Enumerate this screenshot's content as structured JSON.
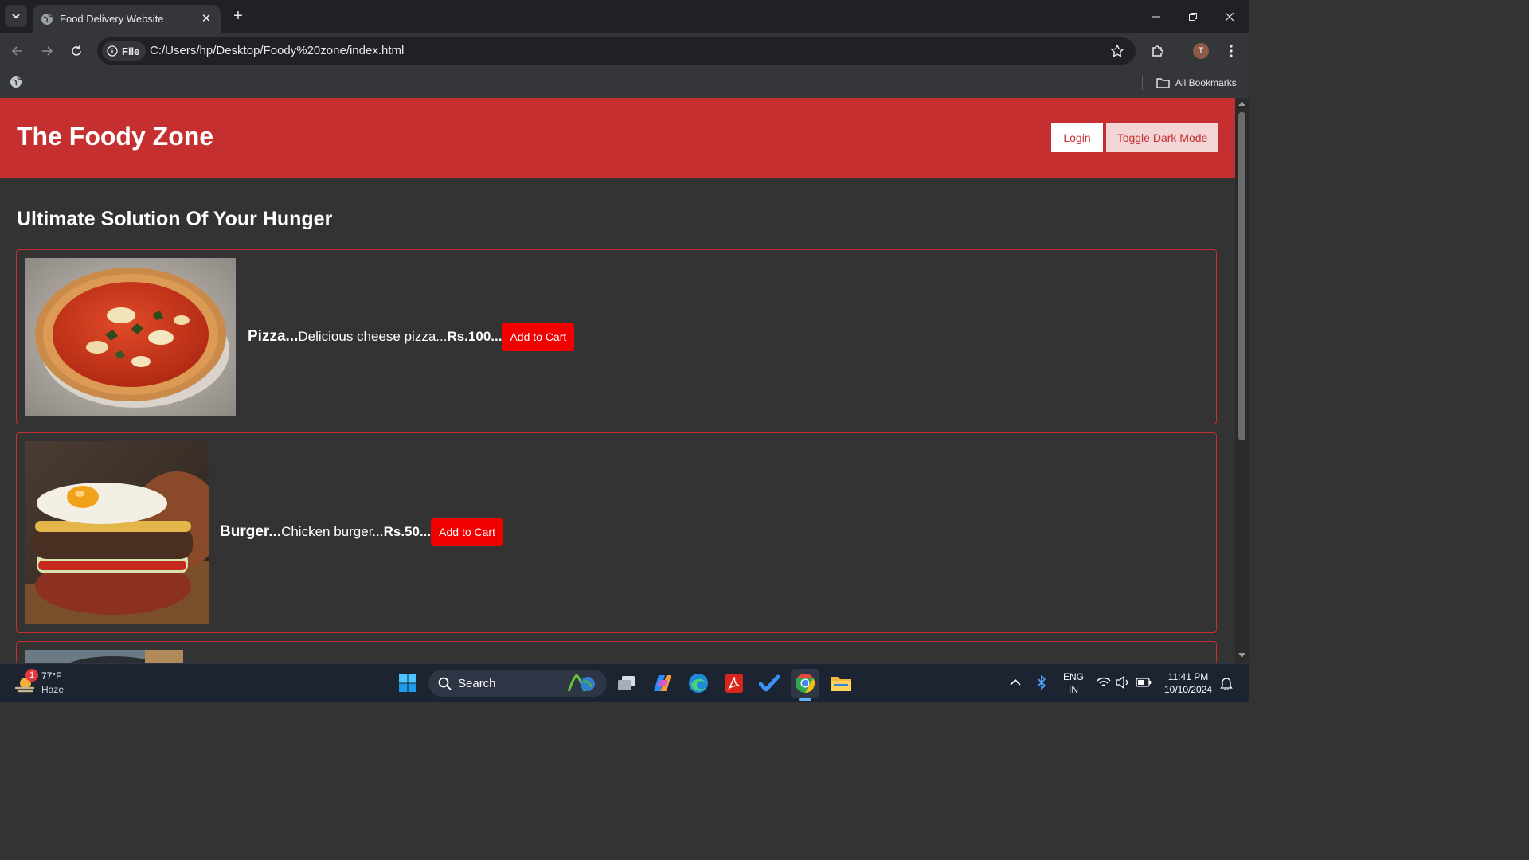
{
  "browser": {
    "tab_title": "Food Delivery Website",
    "url": "C:/Users/hp/Desktop/Foody%20zone/index.html",
    "scheme_chip": "File",
    "profile_initial": "T",
    "bookmarks_label": "All Bookmarks"
  },
  "site": {
    "title": "The Foody Zone",
    "login_label": "Login",
    "dark_mode_label": "Toggle Dark Mode",
    "section_title": "Ultimate Solution Of Your Hunger",
    "items": [
      {
        "name": "Pizza...",
        "description": "Delicious cheese pizza...",
        "price": "Rs.100...",
        "button": "Add to Cart"
      },
      {
        "name": "Burger...",
        "description": "Chicken burger...",
        "price": "Rs.50...",
        "button": "Add to Cart"
      }
    ]
  },
  "taskbar": {
    "weather_temp": "77°F",
    "weather_desc": "Haze",
    "weather_badge": "1",
    "search_label": "Search",
    "lang_top": "ENG",
    "lang_bottom": "IN",
    "time": "11:41 PM",
    "date": "10/10/2024"
  },
  "colors": {
    "header": "#c62f30",
    "page_bg": "#333333",
    "cart_button": "#f10000"
  }
}
